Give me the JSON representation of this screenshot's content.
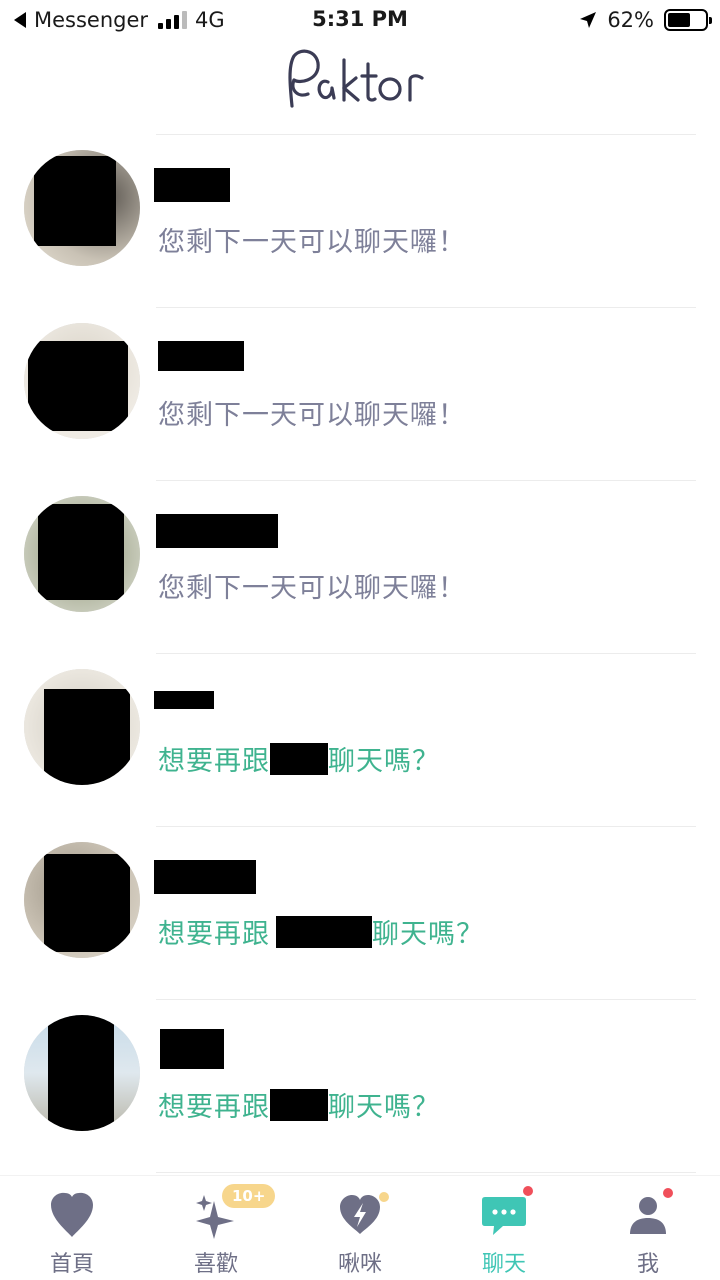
{
  "status_bar": {
    "back_app": "Messenger",
    "network": "4G",
    "time": "5:31 PM",
    "battery": "62%"
  },
  "app": {
    "logo_text": "Paktor"
  },
  "chats": [
    {
      "message": "您剩下一天可以聊天囉！"
    },
    {
      "message": "您剩下一天可以聊天囉！"
    },
    {
      "message": "您剩下一天可以聊天囉！"
    },
    {
      "message_prefix": "想要再跟",
      "message_suffix": "聊天嗎？"
    },
    {
      "message_prefix": "想要再跟",
      "message_suffix": "聊天嗎？"
    },
    {
      "message_prefix": "想要再跟",
      "message_suffix": "聊天嗎？"
    }
  ],
  "tabs": [
    {
      "label": "首頁",
      "icon": "heart-drop-icon"
    },
    {
      "label": "喜歡",
      "icon": "sparkle-icon",
      "badge": "10+"
    },
    {
      "label": "啾咪",
      "icon": "heart-bolt-icon"
    },
    {
      "label": "聊天",
      "icon": "chat-bubble-icon",
      "active": true
    },
    {
      "label": "我",
      "icon": "user-icon"
    }
  ],
  "colors": {
    "accent": "#3fc6b5",
    "teal_text": "#3fb38f",
    "gray_text": "#7e8099",
    "tab_icon": "#6e6f86",
    "notify_dot": "#f04f5a"
  }
}
